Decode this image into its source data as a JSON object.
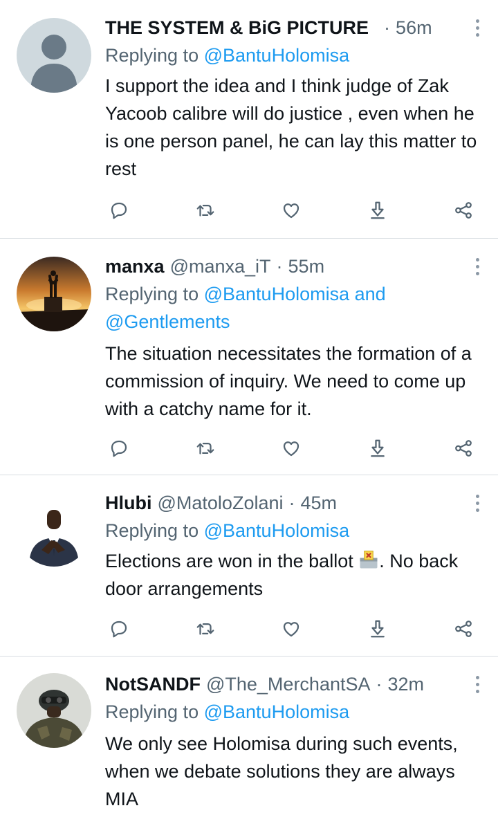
{
  "colors": {
    "accent": "#1d9bf0",
    "secondary_text": "#536471",
    "primary_text": "#0f1419",
    "divider": "#d8dde1"
  },
  "tweets": [
    {
      "name": "THE SYSTEM & BiG PICTURE",
      "handle": "",
      "dot": "·",
      "time": "56m",
      "replying_prefix": "Replying to",
      "mention1": "@BantuHolomisa",
      "and_text": "",
      "mention2": "",
      "text": "I support the idea and I think judge of Zak Yacoob calibre will do justice , even when he is one person panel, he can lay this matter to rest",
      "avatar": "default-avatar"
    },
    {
      "name": "manxa",
      "handle": "@manxa_iT",
      "dot": "·",
      "time": "55m",
      "replying_prefix": "Replying to",
      "mention1": "@BantuHolomisa",
      "and_text": "and",
      "mention2": "@Gentlements",
      "text": "The situation necessitates the formation of a commission of inquiry. We need to come up with a catchy name for it.",
      "avatar": "sunset-avatar"
    },
    {
      "name": "Hlubi",
      "handle": "@MatoloZolani",
      "dot": "·",
      "time": "45m",
      "replying_prefix": "Replying to",
      "mention1": "@BantuHolomisa",
      "and_text": "",
      "mention2": "",
      "text_before_emoji": "Elections are won in the ballot",
      "emoji": "ballot-box-icon",
      "text_after_emoji": ". No back door arrangements",
      "avatar": "suit-avatar"
    },
    {
      "name": "NotSANDF",
      "handle": "@The_MerchantSA",
      "dot": "·",
      "time": "32m",
      "replying_prefix": "Replying to",
      "mention1": "@BantuHolomisa",
      "and_text": "",
      "mention2": "",
      "text": "We only see Holomisa during such events, when we debate solutions they are always MIA",
      "avatar": "soldier-avatar"
    }
  ],
  "action_icons": [
    "reply-icon",
    "retweet-icon",
    "like-icon",
    "download-icon",
    "share-icon"
  ]
}
